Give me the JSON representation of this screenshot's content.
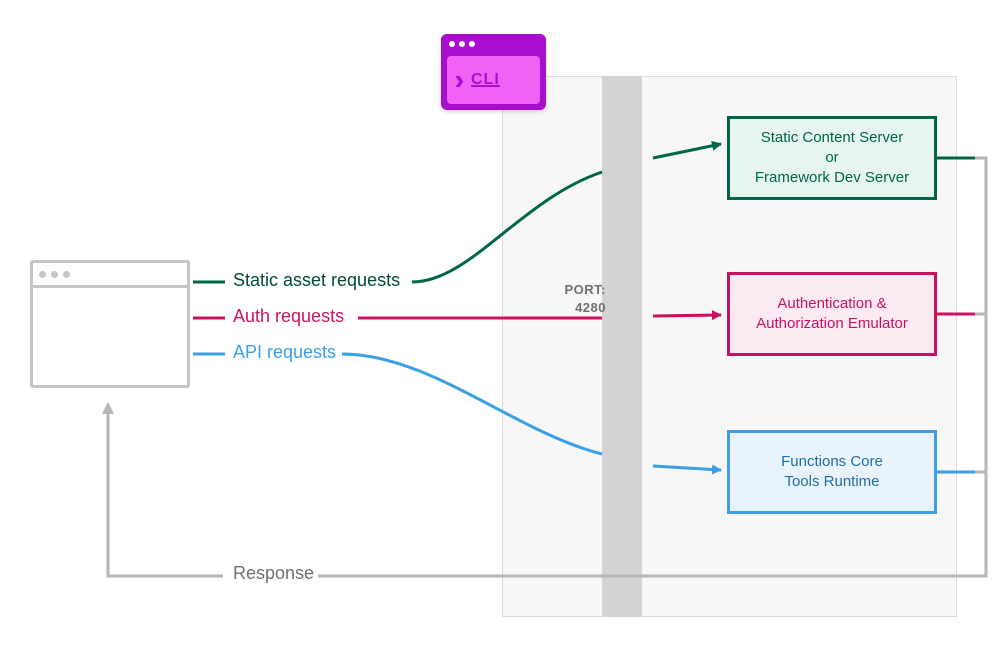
{
  "cli_badge": {
    "label": "CLI"
  },
  "port": {
    "label": "PORT:",
    "number": "4280"
  },
  "flows": {
    "static_assets": "Static asset requests",
    "auth": "Auth requests",
    "api": "API requests",
    "response": "Response"
  },
  "services": {
    "static_content": {
      "line1": "Static Content Server",
      "line2": "or",
      "line3": "Framework Dev Server"
    },
    "auth_emulator": {
      "line1": "Authentication &",
      "line2": "Authorization Emulator"
    },
    "functions_runtime": {
      "line1": "Functions Core",
      "line2": "Tools Runtime"
    }
  },
  "colors": {
    "static": "#006649",
    "auth": "#cb1261",
    "api": "#3a9fe5",
    "grey": "#b6b6b6",
    "port_bg": "#d3d3d3",
    "panel": "#f7f7f7"
  }
}
